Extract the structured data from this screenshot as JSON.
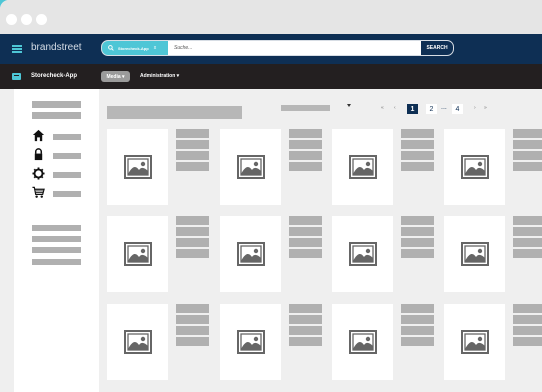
{
  "window": {
    "controls": [
      "close",
      "minimize",
      "maximize"
    ]
  },
  "topbar": {
    "brand": "brandstreet",
    "search": {
      "scope_label": "Storecheck-App",
      "scope_clear": "x",
      "placeholder": "Suche...",
      "button_label": "SEARCH"
    }
  },
  "navbar": {
    "app_name": "Storecheck-App",
    "media_label": "Media ▾",
    "admin_label": "Administration ▾"
  },
  "sidebar": {
    "icons": [
      "home-icon",
      "lock-icon",
      "gear-icon",
      "cart-icon"
    ]
  },
  "pagination": {
    "first": "«",
    "prev": "‹",
    "pages": [
      "1",
      "2",
      "4"
    ],
    "current": "1",
    "ellipsis": "...",
    "next": "›",
    "last": "»"
  },
  "grid": {
    "rows": 3,
    "columns": 4,
    "item_icon": "image-placeholder-icon"
  },
  "colors": {
    "accent": "#4ec6d6",
    "topbar": "#0e2f54",
    "navbar": "#231f20",
    "placeholder": "#b0b0b0"
  }
}
